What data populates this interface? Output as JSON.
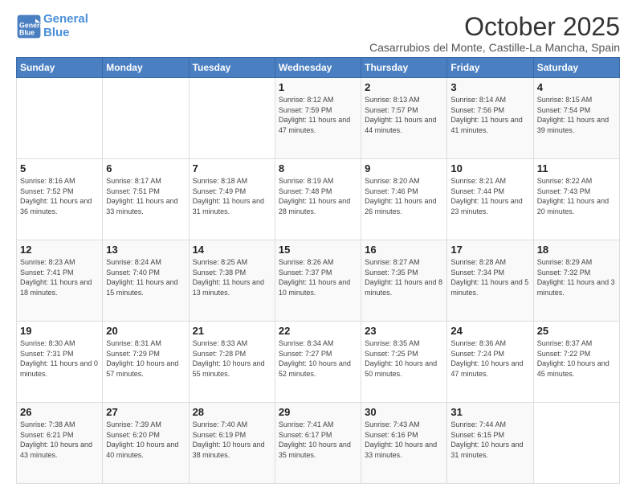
{
  "logo": {
    "line1": "General",
    "line2": "Blue"
  },
  "title": "October 2025",
  "subtitle": "Casarrubios del Monte, Castille-La Mancha, Spain",
  "headers": [
    "Sunday",
    "Monday",
    "Tuesday",
    "Wednesday",
    "Thursday",
    "Friday",
    "Saturday"
  ],
  "weeks": [
    [
      {
        "day": "",
        "info": ""
      },
      {
        "day": "",
        "info": ""
      },
      {
        "day": "",
        "info": ""
      },
      {
        "day": "1",
        "info": "Sunrise: 8:12 AM\nSunset: 7:59 PM\nDaylight: 11 hours and 47 minutes."
      },
      {
        "day": "2",
        "info": "Sunrise: 8:13 AM\nSunset: 7:57 PM\nDaylight: 11 hours and 44 minutes."
      },
      {
        "day": "3",
        "info": "Sunrise: 8:14 AM\nSunset: 7:56 PM\nDaylight: 11 hours and 41 minutes."
      },
      {
        "day": "4",
        "info": "Sunrise: 8:15 AM\nSunset: 7:54 PM\nDaylight: 11 hours and 39 minutes."
      }
    ],
    [
      {
        "day": "5",
        "info": "Sunrise: 8:16 AM\nSunset: 7:52 PM\nDaylight: 11 hours and 36 minutes."
      },
      {
        "day": "6",
        "info": "Sunrise: 8:17 AM\nSunset: 7:51 PM\nDaylight: 11 hours and 33 minutes."
      },
      {
        "day": "7",
        "info": "Sunrise: 8:18 AM\nSunset: 7:49 PM\nDaylight: 11 hours and 31 minutes."
      },
      {
        "day": "8",
        "info": "Sunrise: 8:19 AM\nSunset: 7:48 PM\nDaylight: 11 hours and 28 minutes."
      },
      {
        "day": "9",
        "info": "Sunrise: 8:20 AM\nSunset: 7:46 PM\nDaylight: 11 hours and 26 minutes."
      },
      {
        "day": "10",
        "info": "Sunrise: 8:21 AM\nSunset: 7:44 PM\nDaylight: 11 hours and 23 minutes."
      },
      {
        "day": "11",
        "info": "Sunrise: 8:22 AM\nSunset: 7:43 PM\nDaylight: 11 hours and 20 minutes."
      }
    ],
    [
      {
        "day": "12",
        "info": "Sunrise: 8:23 AM\nSunset: 7:41 PM\nDaylight: 11 hours and 18 minutes."
      },
      {
        "day": "13",
        "info": "Sunrise: 8:24 AM\nSunset: 7:40 PM\nDaylight: 11 hours and 15 minutes."
      },
      {
        "day": "14",
        "info": "Sunrise: 8:25 AM\nSunset: 7:38 PM\nDaylight: 11 hours and 13 minutes."
      },
      {
        "day": "15",
        "info": "Sunrise: 8:26 AM\nSunset: 7:37 PM\nDaylight: 11 hours and 10 minutes."
      },
      {
        "day": "16",
        "info": "Sunrise: 8:27 AM\nSunset: 7:35 PM\nDaylight: 11 hours and 8 minutes."
      },
      {
        "day": "17",
        "info": "Sunrise: 8:28 AM\nSunset: 7:34 PM\nDaylight: 11 hours and 5 minutes."
      },
      {
        "day": "18",
        "info": "Sunrise: 8:29 AM\nSunset: 7:32 PM\nDaylight: 11 hours and 3 minutes."
      }
    ],
    [
      {
        "day": "19",
        "info": "Sunrise: 8:30 AM\nSunset: 7:31 PM\nDaylight: 11 hours and 0 minutes."
      },
      {
        "day": "20",
        "info": "Sunrise: 8:31 AM\nSunset: 7:29 PM\nDaylight: 10 hours and 57 minutes."
      },
      {
        "day": "21",
        "info": "Sunrise: 8:33 AM\nSunset: 7:28 PM\nDaylight: 10 hours and 55 minutes."
      },
      {
        "day": "22",
        "info": "Sunrise: 8:34 AM\nSunset: 7:27 PM\nDaylight: 10 hours and 52 minutes."
      },
      {
        "day": "23",
        "info": "Sunrise: 8:35 AM\nSunset: 7:25 PM\nDaylight: 10 hours and 50 minutes."
      },
      {
        "day": "24",
        "info": "Sunrise: 8:36 AM\nSunset: 7:24 PM\nDaylight: 10 hours and 47 minutes."
      },
      {
        "day": "25",
        "info": "Sunrise: 8:37 AM\nSunset: 7:22 PM\nDaylight: 10 hours and 45 minutes."
      }
    ],
    [
      {
        "day": "26",
        "info": "Sunrise: 7:38 AM\nSunset: 6:21 PM\nDaylight: 10 hours and 43 minutes."
      },
      {
        "day": "27",
        "info": "Sunrise: 7:39 AM\nSunset: 6:20 PM\nDaylight: 10 hours and 40 minutes."
      },
      {
        "day": "28",
        "info": "Sunrise: 7:40 AM\nSunset: 6:19 PM\nDaylight: 10 hours and 38 minutes."
      },
      {
        "day": "29",
        "info": "Sunrise: 7:41 AM\nSunset: 6:17 PM\nDaylight: 10 hours and 35 minutes."
      },
      {
        "day": "30",
        "info": "Sunrise: 7:43 AM\nSunset: 6:16 PM\nDaylight: 10 hours and 33 minutes."
      },
      {
        "day": "31",
        "info": "Sunrise: 7:44 AM\nSunset: 6:15 PM\nDaylight: 10 hours and 31 minutes."
      },
      {
        "day": "",
        "info": ""
      }
    ]
  ]
}
